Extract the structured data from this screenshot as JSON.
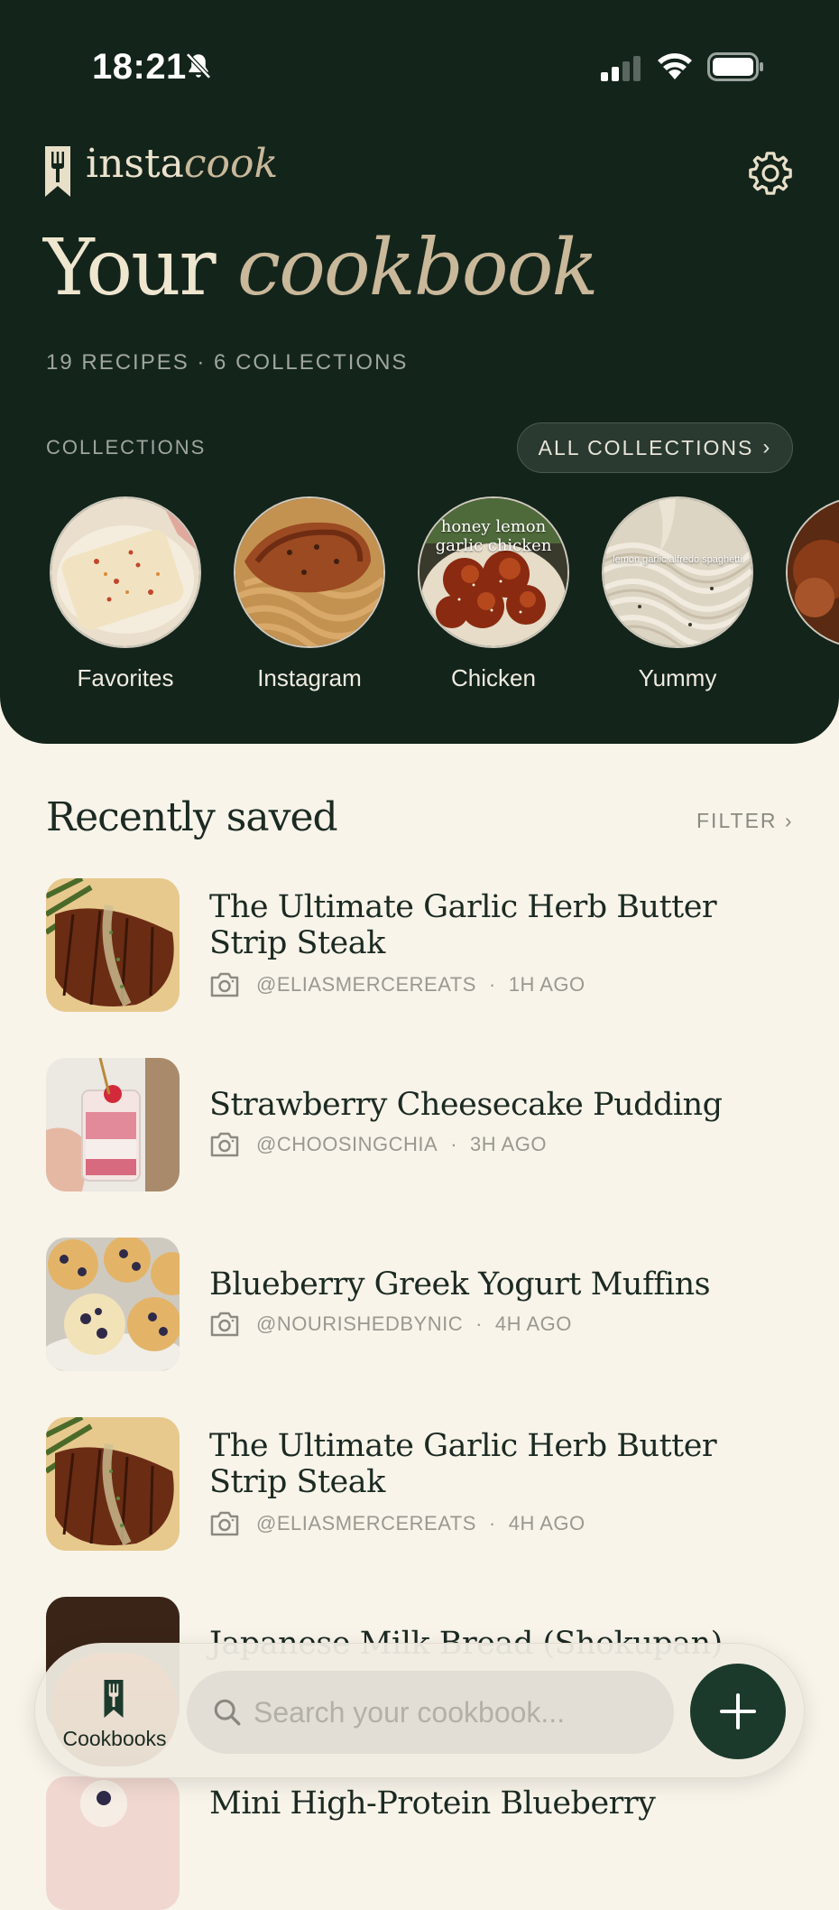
{
  "status": {
    "time": "18:21"
  },
  "app": {
    "logo_part1": "insta",
    "logo_part2": "cook"
  },
  "hero": {
    "title_part1": "Your ",
    "title_part2": "cookbook",
    "stats": "19 RECIPES · 6 COLLECTIONS"
  },
  "collections": {
    "label": "COLLECTIONS",
    "all_label": "ALL COLLECTIONS",
    "items": [
      {
        "name": "Favorites",
        "overlay": ""
      },
      {
        "name": "Instagram",
        "overlay": ""
      },
      {
        "name": "Chicken",
        "overlay": "honey lemon garlic chicken"
      },
      {
        "name": "Yummy",
        "overlay": "lemon garlic alfredo spaghetti"
      }
    ]
  },
  "recent": {
    "title": "Recently saved",
    "filter_label": "FILTER",
    "items": [
      {
        "title": "The Ultimate Garlic Herb Butter Strip Steak",
        "author": "@ELIASMERCEREATS",
        "time": "1H AGO"
      },
      {
        "title": "Strawberry Cheesecake Pudding",
        "author": "@CHOOSINGCHIA",
        "time": "3H AGO"
      },
      {
        "title": "Blueberry Greek Yogurt Muffins",
        "author": "@NOURISHEDBYNIC",
        "time": "4H AGO"
      },
      {
        "title": "The Ultimate Garlic Herb Butter Strip Steak",
        "author": "@ELIASMERCEREATS",
        "time": "4H AGO"
      },
      {
        "title": "Japanese Milk Bread (Shokupan)"
      },
      {
        "title": "Mini High-Protein Blueberry"
      }
    ]
  },
  "bottom": {
    "tab_label": "Cookbooks",
    "search_placeholder": "Search your cookbook..."
  },
  "colors": {
    "header_bg": "#13241b",
    "page_bg": "#f8f4ea",
    "accent": "#1b3a2c",
    "beige": "#c9b89a"
  }
}
